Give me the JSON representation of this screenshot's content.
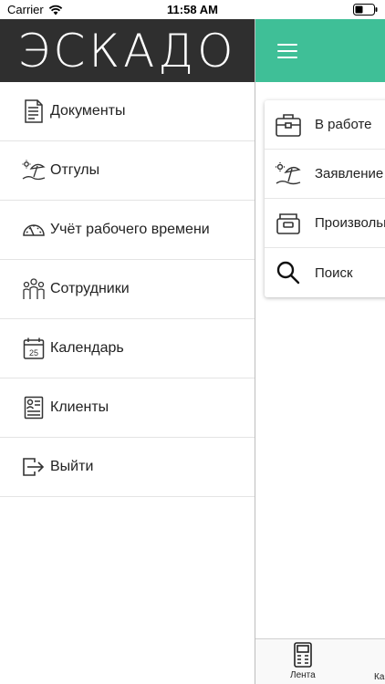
{
  "status_bar": {
    "carrier": "Carrier",
    "time": "11:58 AM"
  },
  "drawer": {
    "logo": "ЭСКАДО",
    "items": [
      {
        "label": "Документы",
        "icon": "document-icon"
      },
      {
        "label": "Отгулы",
        "icon": "beach-umbrella-icon"
      },
      {
        "label": "Учёт рабочего времени",
        "icon": "speedometer-icon"
      },
      {
        "label": "Сотрудники",
        "icon": "people-icon"
      },
      {
        "label": "Календарь",
        "icon": "calendar-icon",
        "badge": "25"
      },
      {
        "label": "Клиенты",
        "icon": "contact-card-icon"
      },
      {
        "label": "Выйти",
        "icon": "logout-icon"
      }
    ]
  },
  "content": {
    "menu_items": [
      {
        "label": "В работе",
        "icon": "briefcase-icon"
      },
      {
        "label": "Заявление",
        "icon": "beach-umbrella-icon"
      },
      {
        "label": "Произвольн",
        "icon": "inbox-tray-icon"
      },
      {
        "label": "Поиск",
        "icon": "search-icon"
      }
    ],
    "tabs": [
      {
        "label": "Лента",
        "icon": "feed-icon"
      },
      {
        "label": "Ка",
        "icon": "calendar-tab-icon"
      }
    ]
  },
  "colors": {
    "header_dark": "#2f2f2f",
    "accent_green": "#3fbf97"
  }
}
